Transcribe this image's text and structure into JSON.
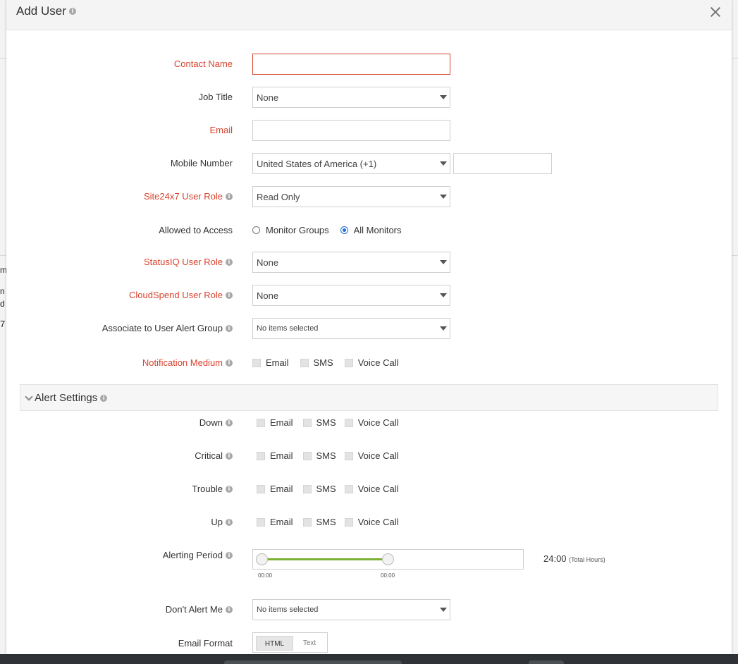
{
  "modal": {
    "title": "Add User"
  },
  "form": {
    "contact_name": {
      "label": "Contact Name",
      "value": ""
    },
    "job_title": {
      "label": "Job Title",
      "value": "None"
    },
    "email": {
      "label": "Email",
      "value": ""
    },
    "mobile_number": {
      "label": "Mobile Number",
      "country": "United States of America (+1)",
      "value": ""
    },
    "user_role": {
      "label": "Site24x7 User Role",
      "value": "Read Only"
    },
    "allowed_access": {
      "label": "Allowed to Access",
      "options": [
        "Monitor Groups",
        "All Monitors"
      ],
      "selected": "All Monitors"
    },
    "statusiq_role": {
      "label": "StatusIQ User Role",
      "value": "None"
    },
    "cloudspend_role": {
      "label": "CloudSpend User Role",
      "value": "None"
    },
    "alert_group": {
      "label": "Associate to User Alert Group",
      "value": "No items selected"
    },
    "notification_medium": {
      "label": "Notification Medium",
      "options": [
        "Email",
        "SMS",
        "Voice Call"
      ]
    }
  },
  "alert_settings": {
    "title": "Alert Settings",
    "rows": [
      {
        "label": "Down",
        "options": [
          "Email",
          "SMS",
          "Voice Call"
        ]
      },
      {
        "label": "Critical",
        "options": [
          "Email",
          "SMS",
          "Voice Call"
        ]
      },
      {
        "label": "Trouble",
        "options": [
          "Email",
          "SMS",
          "Voice Call"
        ]
      },
      {
        "label": "Up",
        "options": [
          "Email",
          "SMS",
          "Voice Call"
        ]
      }
    ],
    "alerting_period": {
      "label": "Alerting Period",
      "start": "00:00",
      "end": "00:00",
      "total_value": "24:00",
      "total_unit": "(Total Hours)"
    },
    "dont_alert": {
      "label": "Don't Alert Me",
      "value": "No items selected"
    },
    "email_format": {
      "label": "Email Format",
      "options": [
        "HTML",
        "Text"
      ],
      "selected": "HTML"
    }
  },
  "colors": {
    "required_label": "#d9432f",
    "radio_selected": "#1e6fd9",
    "slider_fill": "#7bb233"
  },
  "background": {
    "fragments": [
      "m",
      "n",
      "d",
      "7"
    ]
  }
}
